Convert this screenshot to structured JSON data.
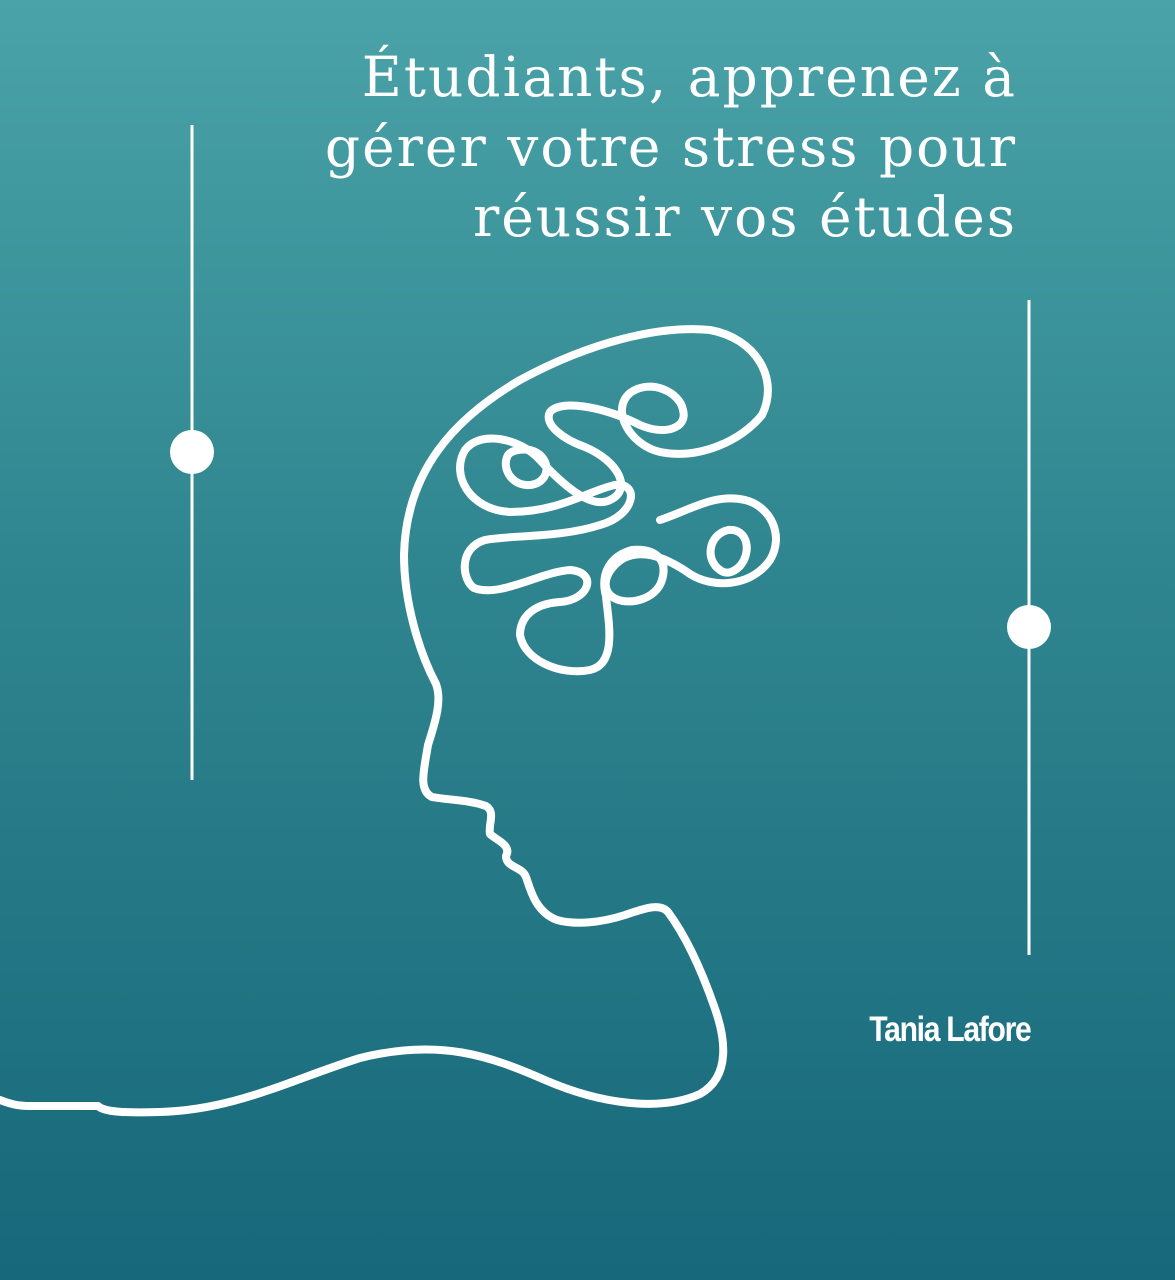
{
  "cover": {
    "title_lines": [
      "Étudiants, apprenez à",
      "gérer votre stress pour",
      "réussir vos études"
    ],
    "author": "Tania Lafore"
  },
  "colors": {
    "background_top": "#4aa3a8",
    "background_bottom": "#17687a",
    "foreground": "#ffffff"
  },
  "illustration": {
    "subject": "head-profile-with-tangled-thoughts-line-art",
    "decorations": [
      "vertical-line-with-dot-left",
      "vertical-line-with-dot-right"
    ]
  }
}
